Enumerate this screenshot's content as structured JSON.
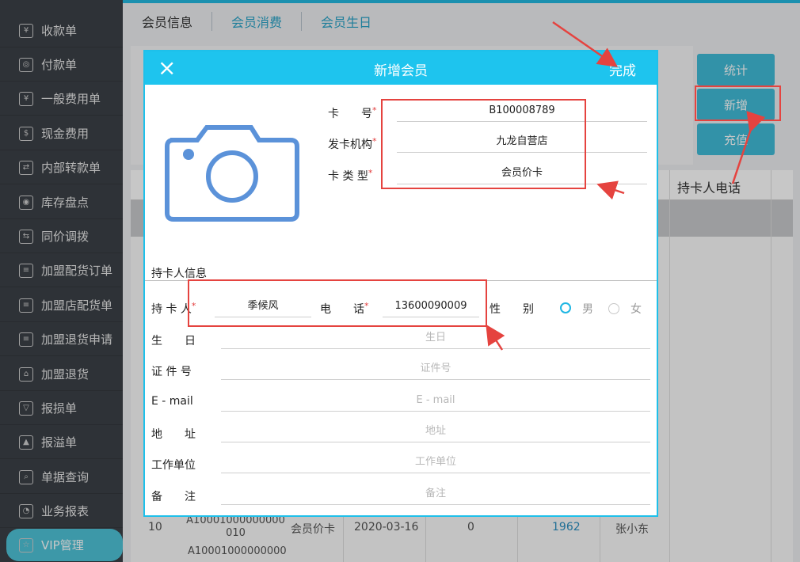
{
  "sidebar": {
    "items": [
      {
        "label": "收款单",
        "icon": "receipt-icon",
        "glyph": "¥"
      },
      {
        "label": "付款单",
        "icon": "payment-icon",
        "glyph": "◎"
      },
      {
        "label": "一般费用单",
        "icon": "yen-circle-icon",
        "glyph": "¥"
      },
      {
        "label": "现金费用",
        "icon": "money-bag-icon",
        "glyph": "$"
      },
      {
        "label": "内部转款单",
        "icon": "transfer-icon",
        "glyph": "⇄"
      },
      {
        "label": "库存盘点",
        "icon": "inventory-icon",
        "glyph": "◉"
      },
      {
        "label": "同价调拨",
        "icon": "cart-icon",
        "glyph": "⇆"
      },
      {
        "label": "加盟配货订单",
        "icon": "clipboard-icon",
        "glyph": "≡"
      },
      {
        "label": "加盟店配货单",
        "icon": "list-icon",
        "glyph": "≡"
      },
      {
        "label": "加盟退货申请",
        "icon": "return-request-icon",
        "glyph": "≡"
      },
      {
        "label": "加盟退货",
        "icon": "home-icon",
        "glyph": "⌂"
      },
      {
        "label": "报损单",
        "icon": "damage-icon",
        "glyph": "▽"
      },
      {
        "label": "报溢单",
        "icon": "overflow-icon",
        "glyph": "▲"
      },
      {
        "label": "单据查询",
        "icon": "search-icon",
        "glyph": "⌕"
      },
      {
        "label": "业务报表",
        "icon": "pie-chart-icon",
        "glyph": "◔"
      },
      {
        "label": "VIP管理",
        "icon": "star-icon",
        "glyph": "☆"
      }
    ],
    "collapse_glyph": "«"
  },
  "tabs": [
    "会员信息",
    "会员消费",
    "会员生日"
  ],
  "buttons": {
    "stats": "统计",
    "add": "新增",
    "recharge": "充值"
  },
  "grid": {
    "header_phone": "持卡人电话",
    "row": {
      "no": "10",
      "card": "A10001000000000010",
      "type": "会员价卡",
      "date": "2020-03-16",
      "balance": "0",
      "year": "1962",
      "holder": "张小东"
    },
    "next_row_card": "A10001000000000"
  },
  "modal": {
    "close": "×",
    "title": "新增会员",
    "done": "完成",
    "card_no_label": "卡　　号",
    "card_no": "B100008789",
    "issuer_label": "发卡机构",
    "issuer": "九龙自营店",
    "card_type_label": "卡 类 型",
    "card_type": "会员价卡",
    "section": "持卡人信息",
    "holder_label": "持 卡 人",
    "holder": "季候风",
    "phone_label": "电　　话",
    "phone": "13600090009",
    "gender_label": "性　　别",
    "male": "男",
    "female": "女",
    "birthday_label": "生　　日",
    "birthday_ph": "生日",
    "id_label": "证 件 号",
    "id_ph": "证件号",
    "email_label": "E - mail",
    "email_ph": "E - mail",
    "address_label": "地　　址",
    "address_ph": "地址",
    "company_label": "工作单位",
    "company_ph": "工作单位",
    "note_label": "备　　注",
    "note_ph": "备注"
  },
  "colors": {
    "accent": "#1ec4ee",
    "sidebar": "#3c4147",
    "annotation": "#e5433f",
    "required": "#e23b3b"
  }
}
